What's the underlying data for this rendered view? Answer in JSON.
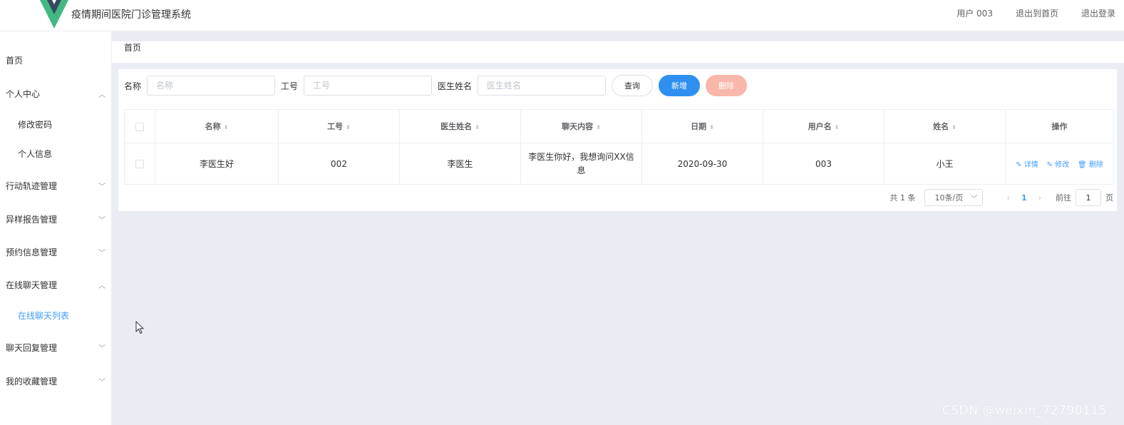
{
  "header": {
    "title": "疫情期间医院门诊管理系统",
    "logo_icon": "vue-logo-icon",
    "links": [
      "用户 003",
      "退出到首页",
      "退出登录"
    ]
  },
  "sidebar": {
    "items": [
      {
        "label": "首页"
      },
      {
        "label": "个人中心",
        "expanded": true
      },
      {
        "label": "修改密码",
        "sub": true
      },
      {
        "label": "个人信息",
        "sub": true
      },
      {
        "label": "行动轨迹管理"
      },
      {
        "label": "异样报告管理"
      },
      {
        "label": "预约信息管理"
      },
      {
        "label": "在线聊天管理",
        "expanded": true
      },
      {
        "label": "在线聊天列表",
        "sub": true,
        "active": true
      },
      {
        "label": "聊天回复管理"
      },
      {
        "label": "我的收藏管理"
      }
    ]
  },
  "breadcrumb": "首页",
  "search": {
    "fields": [
      {
        "label": "名称",
        "placeholder": "名称",
        "value": ""
      },
      {
        "label": "工号",
        "placeholder": "工号",
        "value": ""
      },
      {
        "label": "医生姓名",
        "placeholder": "医生姓名",
        "value": ""
      }
    ],
    "query_label": "查询",
    "add_label": "新增",
    "delete_label": "删除"
  },
  "table": {
    "columns": [
      "名称",
      "工号",
      "医生姓名",
      "聊天内容",
      "日期",
      "用户名",
      "姓名",
      "操作"
    ],
    "rows": [
      {
        "name": "李医生好",
        "id": "002",
        "doctor": "李医生",
        "content": "李医生你好，我想询问XX信息",
        "date": "2020-09-30",
        "username": "003",
        "realname": "小王"
      }
    ],
    "actions": [
      "详情",
      "修改",
      "删除"
    ]
  },
  "pagination": {
    "total": "共 1 条",
    "page_size": "10条/页",
    "current": "1",
    "goto_prefix": "前往",
    "goto_value": "1",
    "goto_suffix": "页"
  },
  "watermark": "CSDN @weixin_72790115",
  "colors": {
    "accent": "#409eff",
    "add_button": "#2f8ff0",
    "delete_button": "#f9b6aa",
    "content_bg": "#e9edf3"
  }
}
